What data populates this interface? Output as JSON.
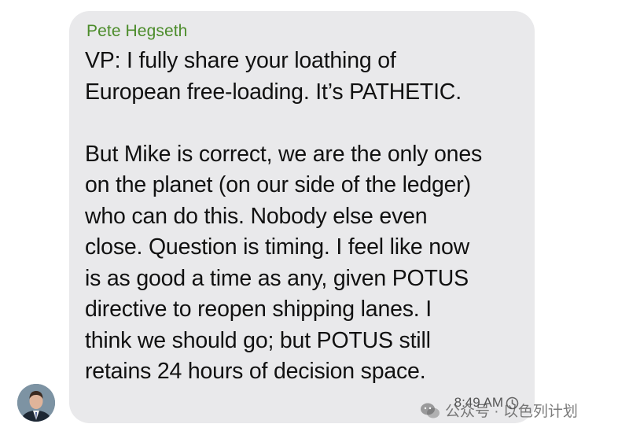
{
  "message": {
    "sender": "Pete Hegseth",
    "text": "VP: I fully share your loathing of\nEuropean free-loading. It’s PATHETIC.\n\nBut Mike is correct, we are the only ones\non the planet (on our side of the ledger)\nwho can do this. Nobody else even\nclose. Question is timing. I feel like now\nis as good a time as any, given POTUS\ndirective to reopen shipping lanes. I\nthink we should go; but POTUS still\nretains 24 hours of decision space.",
    "time": "8:49 AM",
    "time_icon": "clock-icon"
  },
  "avatar": {
    "icon": "avatar"
  },
  "watermark": {
    "text": "公众号 · 以色列计划",
    "icon": "wechat-icon"
  },
  "colors": {
    "bubble_bg": "#e9e9eb",
    "sender_name": "#4c8c2b",
    "text": "#111111"
  }
}
